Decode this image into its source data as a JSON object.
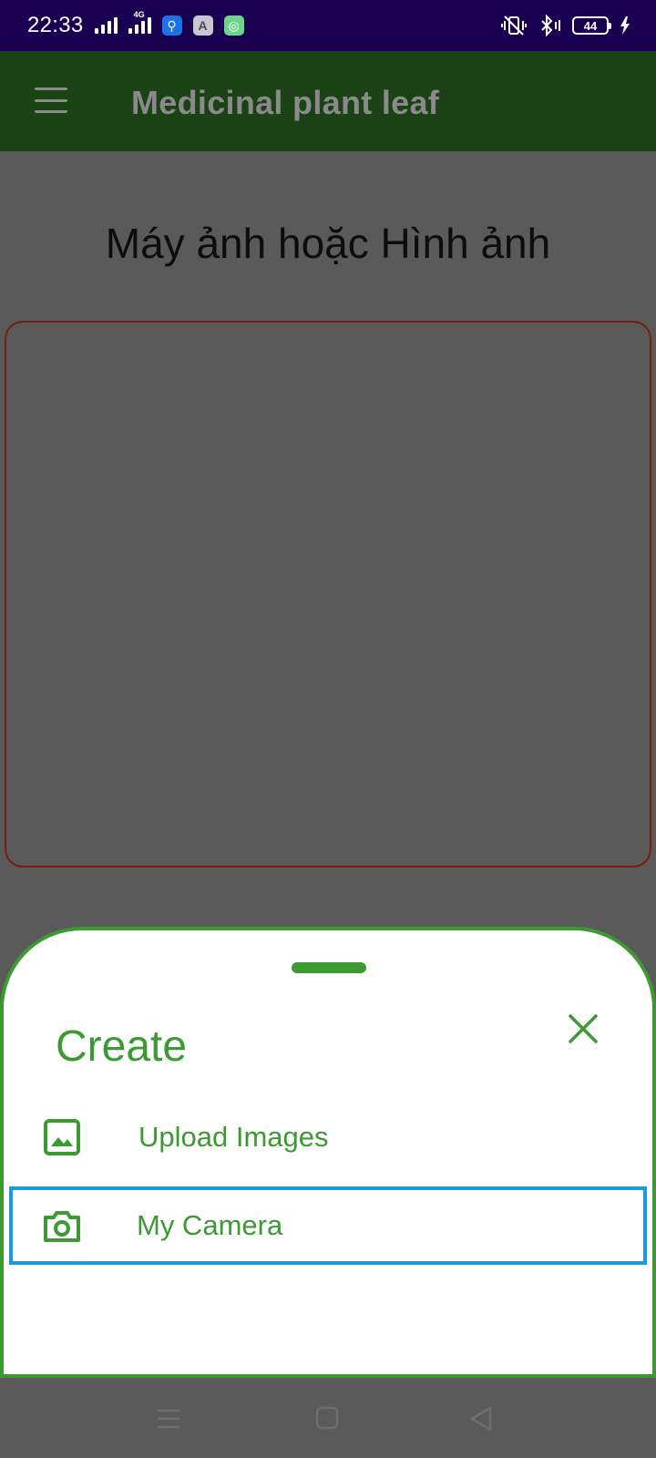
{
  "status_bar": {
    "time": "22:33",
    "network_type": "4G",
    "battery_level": "44",
    "background_color": "#1a0050"
  },
  "app_bar": {
    "title": "Medicinal plant leaf",
    "menu_icon": "hamburger-menu-icon",
    "background_color": "#1a4215"
  },
  "main": {
    "heading": "Máy ảnh hoặc Hình ảnh",
    "image_preview_border_color": "#7a1a12"
  },
  "sheet": {
    "title": "Create",
    "close_icon": "close-icon",
    "accent_color": "#3d9a33",
    "options": [
      {
        "label": "Upload Images",
        "icon": "image-icon",
        "highlighted": false
      },
      {
        "label": "My Camera",
        "icon": "camera-icon",
        "highlighted": true
      }
    ],
    "highlight_color": "#1a9be0"
  },
  "nav_bar": {
    "buttons": [
      "recents-icon",
      "home-icon",
      "back-icon"
    ]
  }
}
